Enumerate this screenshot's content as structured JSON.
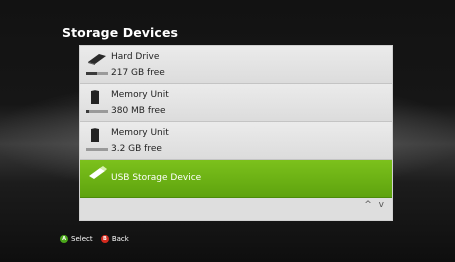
{
  "screen": {
    "title": "Storage Devices"
  },
  "devices": [
    {
      "name": "Hard Drive",
      "free": "217 GB free",
      "icon": "hard-drive-icon",
      "used_fraction": 0.5
    },
    {
      "name": "Memory Unit",
      "free": "380 MB free",
      "icon": "memory-unit-icon",
      "used_fraction": 0.15
    },
    {
      "name": "Memory Unit",
      "free": "3.2 GB free",
      "icon": "memory-unit-icon",
      "used_fraction": 0.0
    },
    {
      "name": "USB Storage Device",
      "icon": "usb-drive-icon",
      "selected": true
    }
  ],
  "scroll": {
    "arrows": "^ v"
  },
  "footer": {
    "select": {
      "glyph": "A",
      "label": "Select",
      "color": "#4aa61a"
    },
    "back": {
      "glyph": "B",
      "label": "Back",
      "color": "#d42a1e"
    }
  },
  "colors": {
    "selected_bg": "#6cb416",
    "panel_bg": "#f0f0f0"
  }
}
